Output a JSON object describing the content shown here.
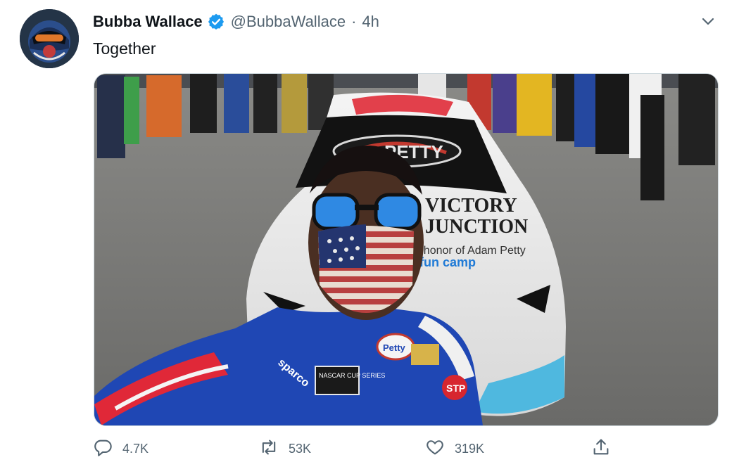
{
  "tweet": {
    "author_name": "Bubba Wallace",
    "handle": "@BubbaWallace",
    "separator": "·",
    "time": "4h",
    "text": "Together"
  },
  "actions": {
    "replies": "4.7K",
    "retweets": "53K",
    "likes": "319K"
  },
  "media": {
    "car_sponsor_lines": [
      "VICTORY",
      "JUNCTION",
      "In honor of Adam Petty",
      "fun camp"
    ],
    "team_logo": "PETTY",
    "suit_sponsors": [
      "sparco",
      "NASCAR CUP SERIES",
      "STP",
      "Petty"
    ]
  },
  "icons": {
    "verified": "verified-badge-icon",
    "caret": "chevron-down-icon",
    "reply": "reply-icon",
    "retweet": "retweet-icon",
    "like": "heart-icon",
    "share": "share-icon"
  },
  "colors": {
    "verified": "#1d9bf0",
    "text_secondary": "#536471",
    "text_primary": "#0f1419"
  }
}
